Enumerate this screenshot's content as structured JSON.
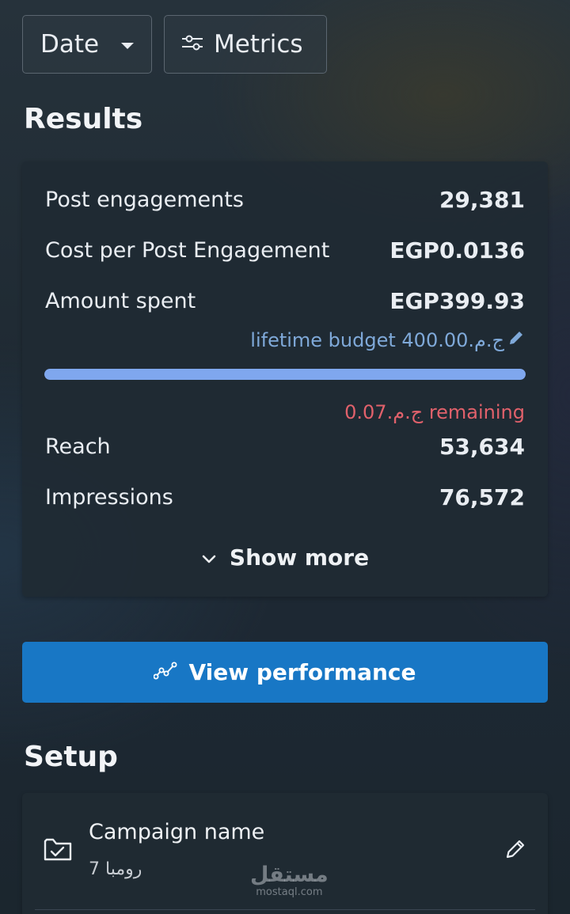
{
  "toolbar": {
    "date_label": "Date",
    "metrics_label": "Metrics"
  },
  "results": {
    "title": "Results",
    "rows": [
      {
        "label": "Post engagements",
        "value": "29,381"
      },
      {
        "label": "Cost per Post Engagement",
        "value": "EGP0.0136"
      },
      {
        "label": "Amount spent",
        "value": "EGP399.93"
      }
    ],
    "budget_text": "lifetime budget 400.00.ج.م",
    "budget_progress": 0.9998,
    "remaining_text": "0.07.ج.م remaining",
    "rows2": [
      {
        "label": "Reach",
        "value": "53,634"
      },
      {
        "label": "Impressions",
        "value": "76,572"
      }
    ],
    "show_more_label": "Show more"
  },
  "view_performance_label": "View performance",
  "setup": {
    "title": "Setup",
    "campaign_label": "Campaign name",
    "campaign_value": "رومبا 7"
  },
  "watermark": {
    "arabic": "مستقل",
    "latin": "mostaql.com"
  },
  "colors": {
    "accent": "#1877c5",
    "progress": "#7fa7ee",
    "budget_link": "#7fa9d9",
    "remaining": "#e1616b"
  }
}
